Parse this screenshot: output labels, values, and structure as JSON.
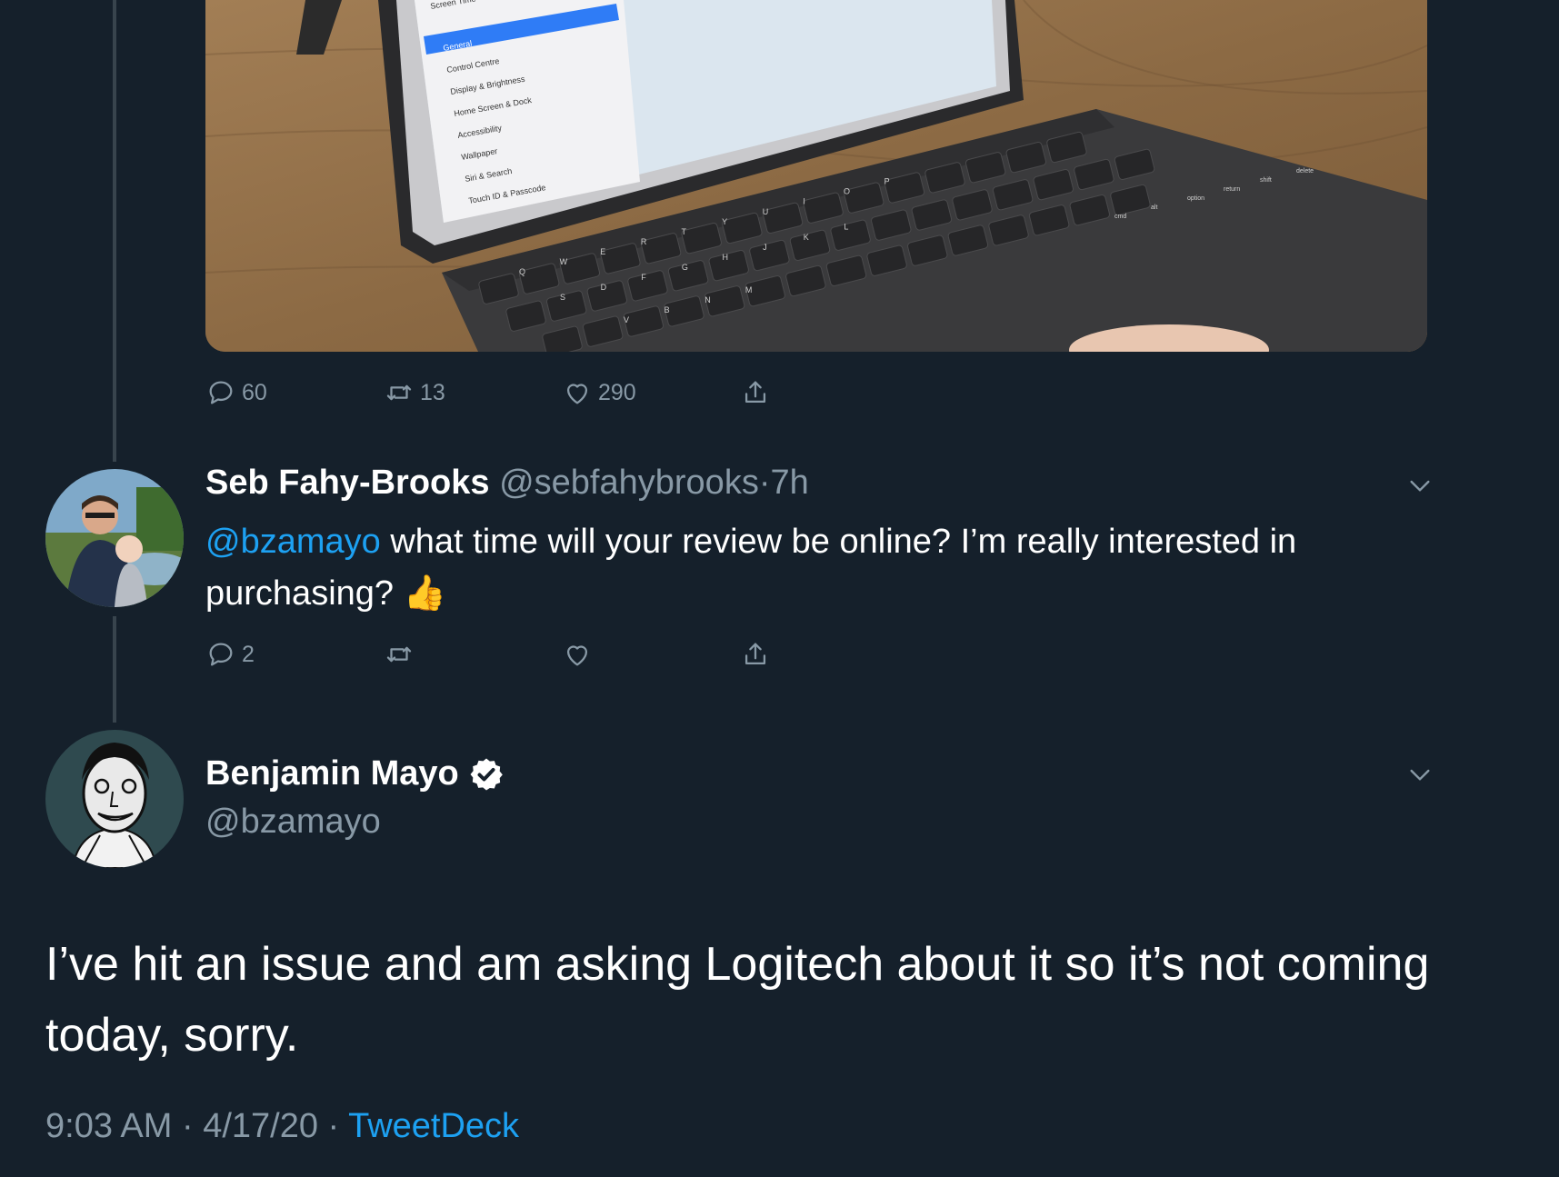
{
  "colors": {
    "background": "#15202b",
    "secondary_text": "#8899a6",
    "accent": "#1da1f2",
    "divider": "#38444d"
  },
  "previous_tweet": {
    "image": {
      "settings_items": [
        "Screen Time",
        "General",
        "Control Centre",
        "Display & Brightness",
        "Home Screen & Dock",
        "Accessibility",
        "Wallpaper",
        "Siri & Search",
        "Touch ID & Passcode"
      ],
      "keyboard_letters": [
        "Q",
        "W",
        "E",
        "R",
        "T",
        "Y",
        "U",
        "I",
        "O",
        "P",
        "S",
        "D",
        "F",
        "G",
        "H",
        "J",
        "K",
        "L",
        "V",
        "B",
        "N",
        "M"
      ],
      "keyboard_labels": [
        "cmd",
        "alt",
        "option",
        "return",
        "shift",
        "delete"
      ]
    },
    "actions": {
      "replies": "60",
      "retweets": "13",
      "likes": "290"
    }
  },
  "reply": {
    "author_name": "Seb Fahy-Brooks",
    "handle": "@sebfahybrooks",
    "separator": "·",
    "time": "7h",
    "mention": "@bzamayo",
    "text": " what time will your review be online? I’m really interested in purchasing? ",
    "emoji": "👍",
    "actions": {
      "replies": "2"
    }
  },
  "main_tweet": {
    "author_name": "Benjamin Mayo",
    "handle": "@bzamayo",
    "text": "I’ve hit an issue and am asking Logitech about it so it’s not coming today, sorry.",
    "time": "9:03 AM",
    "sep1": " · ",
    "date": "4/17/20",
    "sep2": " · ",
    "source": "TweetDeck"
  }
}
